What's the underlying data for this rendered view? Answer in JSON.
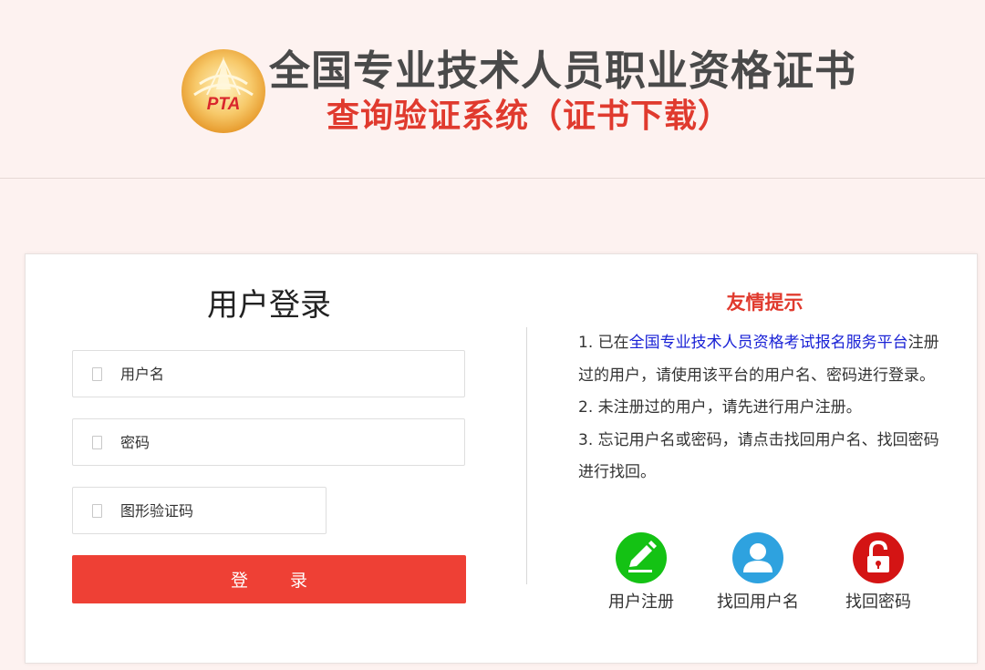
{
  "header": {
    "logo_text": "PTA",
    "title_main": "全国专业技术人员职业资格证书",
    "title_sub": "查询验证系统（证书下载）"
  },
  "login": {
    "title": "用户登录",
    "username_placeholder": "用户名",
    "password_placeholder": "密码",
    "captcha_placeholder": "图形验证码",
    "submit_label": "登 录"
  },
  "tips": {
    "title": "友情提示",
    "line1_prefix": "1. 已在",
    "line1_link": "全国专业技术人员资格考试报名服务平台",
    "line1_suffix": "注册过的用户，请使用该平台的用户名、密码进行登录。",
    "line2": "2. 未注册过的用户，请先进行用户注册。",
    "line3": "3. 忘记用户名或密码，请点击找回用户名、找回密码进行找回。"
  },
  "actions": {
    "register": {
      "label": "用户注册",
      "icon": "pencil-icon"
    },
    "find_username": {
      "label": "找回用户名",
      "icon": "user-icon"
    },
    "find_password": {
      "label": "找回密码",
      "icon": "lock-icon"
    }
  },
  "colors": {
    "accent_red": "#e03a2e",
    "button_red": "#ee4035",
    "link_blue": "#1a22d6",
    "register_green": "#14c214",
    "username_blue": "#2ea2df",
    "password_red": "#d41414"
  }
}
